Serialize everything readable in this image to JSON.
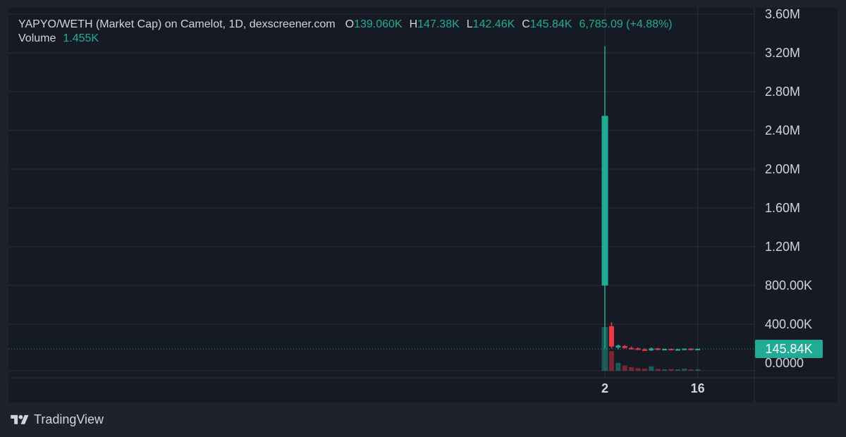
{
  "legend": {
    "title": "YAPYO/WETH (Market Cap) on Camelot, 1D, dexscreener.com",
    "open_label": "O",
    "open": "139.060K",
    "high_label": "H",
    "high": "147.38K",
    "low_label": "L",
    "low": "142.46K",
    "close_label": "C",
    "close": "145.84K",
    "change": "6,785.09 (+4.88%)",
    "volume_label": "Volume",
    "volume": "1.455K"
  },
  "brand": {
    "name": "TradingView",
    "icon": "tradingview-logo-icon"
  },
  "colors": {
    "background": "#161a25",
    "frame": "#1e222d",
    "grid": "#2a2e39",
    "up": "#22ab94",
    "down": "#f23645",
    "text": "#d1d4dc"
  },
  "chart_data": {
    "type": "candlestick",
    "price_label": "145.84K",
    "price_value": 145840,
    "y_ticks": [
      "3.60M",
      "3.20M",
      "2.80M",
      "2.40M",
      "2.00M",
      "1.60M",
      "1.20M",
      "800.00K",
      "400.00K",
      "0.0000"
    ],
    "y_tick_values": [
      3600000,
      3200000,
      2800000,
      2400000,
      2000000,
      1600000,
      1200000,
      800000,
      400000,
      0
    ],
    "ylim": [
      -20000,
      3600000
    ],
    "x_ticks": [
      "2",
      "16"
    ],
    "x_tick_days": [
      2,
      16
    ],
    "xlim": [
      -89,
      22
    ],
    "candles": [
      {
        "day": 2,
        "open": 800000,
        "high": 3270000,
        "low": 150000,
        "close": 2550000,
        "volume": 100
      },
      {
        "day": 3,
        "open": 380000,
        "high": 420000,
        "low": 150000,
        "close": 170000,
        "volume": 45
      },
      {
        "day": 4,
        "open": 160000,
        "high": 190000,
        "low": 140000,
        "close": 180000,
        "volume": 18
      },
      {
        "day": 5,
        "open": 175000,
        "high": 185000,
        "low": 150000,
        "close": 155000,
        "volume": 12
      },
      {
        "day": 6,
        "open": 155000,
        "high": 170000,
        "low": 145000,
        "close": 150000,
        "volume": 8
      },
      {
        "day": 7,
        "open": 150000,
        "high": 160000,
        "low": 135000,
        "close": 140000,
        "volume": 6
      },
      {
        "day": 8,
        "open": 140000,
        "high": 150000,
        "low": 125000,
        "close": 130000,
        "volume": 5
      },
      {
        "day": 9,
        "open": 130000,
        "high": 160000,
        "low": 125000,
        "close": 150000,
        "volume": 10
      },
      {
        "day": 10,
        "open": 150000,
        "high": 155000,
        "low": 135000,
        "close": 140000,
        "volume": 4
      },
      {
        "day": 11,
        "open": 140000,
        "high": 148000,
        "low": 132000,
        "close": 145000,
        "volume": 3
      },
      {
        "day": 12,
        "open": 145000,
        "high": 150000,
        "low": 135000,
        "close": 138000,
        "volume": 4
      },
      {
        "day": 13,
        "open": 138000,
        "high": 145000,
        "low": 132000,
        "close": 142000,
        "volume": 3
      },
      {
        "day": 14,
        "open": 142000,
        "high": 150000,
        "low": 138000,
        "close": 148000,
        "volume": 5
      },
      {
        "day": 15,
        "open": 148000,
        "high": 152000,
        "low": 138000,
        "close": 140000,
        "volume": 3
      },
      {
        "day": 16,
        "open": 139060,
        "high": 147380,
        "low": 142460,
        "close": 145840,
        "volume": 2
      }
    ]
  }
}
